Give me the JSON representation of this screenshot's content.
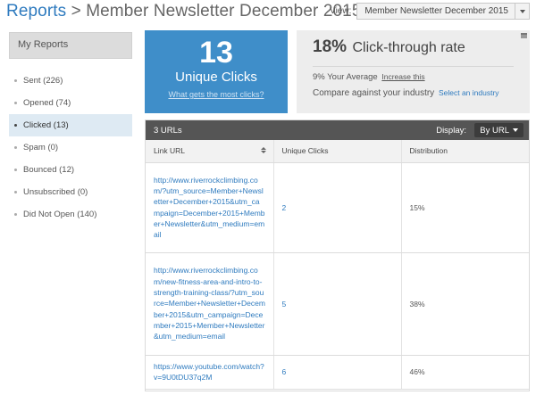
{
  "header": {
    "reports_label": "Reports",
    "separator": " > ",
    "title": "Member Newsletter December 2015",
    "view_label": "View:",
    "view_value": "Member Newsletter December 2015"
  },
  "sidebar": {
    "title": "My Reports",
    "items": [
      {
        "label": "Sent (226)"
      },
      {
        "label": "Opened (74)"
      },
      {
        "label": "Clicked (13)"
      },
      {
        "label": "Spam (0)"
      },
      {
        "label": "Bounced (12)"
      },
      {
        "label": "Unsubscribed (0)"
      },
      {
        "label": "Did Not Open (140)"
      }
    ],
    "active_index": 2
  },
  "summary": {
    "unique_clicks": "13",
    "unique_clicks_label": "Unique Clicks",
    "most_clicks_link": "What gets the most clicks?",
    "ctr_pct": "18%",
    "ctr_label": "Click-through rate",
    "avg_text": "9% Your Average",
    "increase_link": "Increase this",
    "compare_text": "Compare against your industry",
    "industry_link": "Select an industry"
  },
  "table": {
    "count_label": "3 URLs",
    "display_label": "Display:",
    "display_value": "By URL",
    "columns": [
      "Link URL",
      "Unique Clicks",
      "Distribution"
    ],
    "rows": [
      {
        "url": "http://www.riverrockclimbing.com/?utm_source=Member+Newsletter+December+2015&utm_campaign=December+2015+Member+Newsletter&utm_medium=email",
        "clicks": "2",
        "distribution": "15%"
      },
      {
        "url": "http://www.riverrockclimbing.com/new-fitness-area-and-intro-to-strength-training-class/?utm_source=Member+Newsletter+December+2015&utm_campaign=December+2015+Member+Newsletter&utm_medium=email",
        "clicks": "5",
        "distribution": "38%"
      },
      {
        "url": "https://www.youtube.com/watch?v=9U0tDU37q2M",
        "clicks": "6",
        "distribution": "46%"
      }
    ]
  },
  "colors": {
    "accent_blue": "#3f8ec9",
    "link_blue": "#2f7bbf",
    "table_bar": "#555555",
    "active_item_bg": "#deeaf3"
  }
}
